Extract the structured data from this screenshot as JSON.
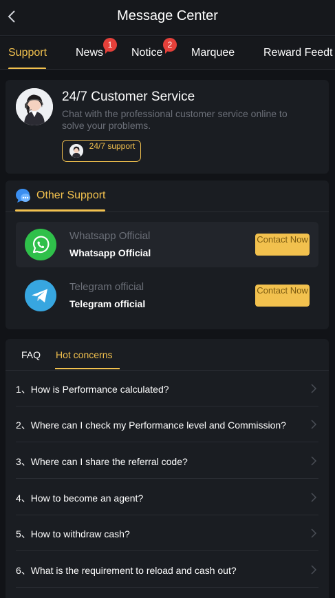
{
  "header": {
    "title": "Message Center"
  },
  "tabs": [
    {
      "label": "Support",
      "badge": ""
    },
    {
      "label": "News",
      "badge": "1"
    },
    {
      "label": "Notice",
      "badge": "2"
    },
    {
      "label": "Marquee",
      "badge": ""
    },
    {
      "label": "Reward Feedt",
      "badge": ""
    }
  ],
  "customer_service": {
    "title": "24/7 Customer Service",
    "description": "Chat with the professional customer service online to solve your problems.",
    "button_label": "24/7 support"
  },
  "other_support": {
    "title": "Other Support",
    "contacts": [
      {
        "name": "Whatsapp Official",
        "subname": "Whatsapp Official",
        "button": "Contact Now",
        "icon": "whatsapp-icon"
      },
      {
        "name": "Telegram official",
        "subname": "Telegram official",
        "button": "Contact Now",
        "icon": "telegram-icon"
      }
    ]
  },
  "faq": {
    "tabs": [
      {
        "label": "FAQ"
      },
      {
        "label": "Hot concerns"
      }
    ],
    "items": [
      "1、How is Performance calculated?",
      "2、Where can I check my Performance level and Commission?",
      "3、Where can I share the referral code?",
      "4、How to become an agent?",
      "5、How to withdraw cash?",
      "6、What is the requirement to reload and cash out?"
    ]
  },
  "colors": {
    "accent": "#f2c14e",
    "badge": "#e5403a",
    "background": "#111317",
    "card": "#1a1d22"
  }
}
